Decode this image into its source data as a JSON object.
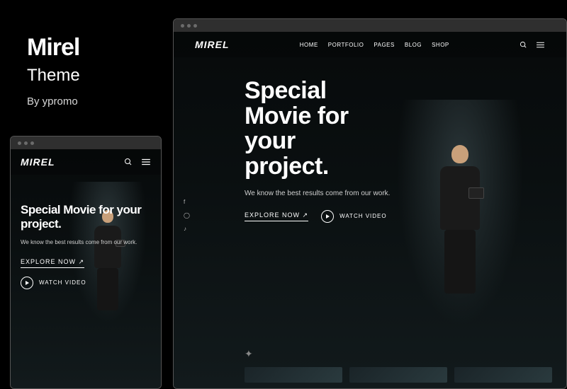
{
  "product": {
    "title": "Mirel",
    "subtitle": "Theme",
    "byline": "By ypromo"
  },
  "brand": {
    "logo": "MIREL"
  },
  "nav": {
    "items": [
      "HOME",
      "PORTFOLIO",
      "PAGES",
      "BLOG",
      "SHOP"
    ]
  },
  "hero": {
    "headline_lines_desktop": [
      "Special",
      "Movie for",
      "your",
      "project."
    ],
    "headline_mobile": "Special Movie for your project.",
    "subtext": "We know the best results come from our work.",
    "explore_label": "EXPLORE NOW ↗",
    "watch_label": "WATCH VIDEO"
  },
  "socials": {
    "items": [
      "f",
      "◯",
      "♪"
    ]
  }
}
